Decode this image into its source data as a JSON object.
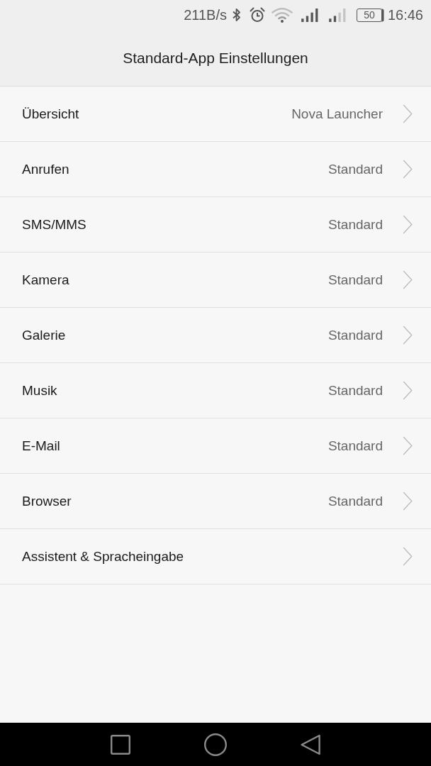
{
  "status_bar": {
    "network_speed": "211B/s",
    "battery": "50",
    "time": "16:46"
  },
  "title": "Standard-App Einstellungen",
  "items": [
    {
      "label": "Übersicht",
      "value": "Nova Launcher"
    },
    {
      "label": "Anrufen",
      "value": "Standard"
    },
    {
      "label": "SMS/MMS",
      "value": "Standard"
    },
    {
      "label": "Kamera",
      "value": "Standard"
    },
    {
      "label": "Galerie",
      "value": "Standard"
    },
    {
      "label": "Musik",
      "value": "Standard"
    },
    {
      "label": "E-Mail",
      "value": "Standard"
    },
    {
      "label": "Browser",
      "value": "Standard"
    },
    {
      "label": "Assistent & Spracheingabe"
    }
  ]
}
